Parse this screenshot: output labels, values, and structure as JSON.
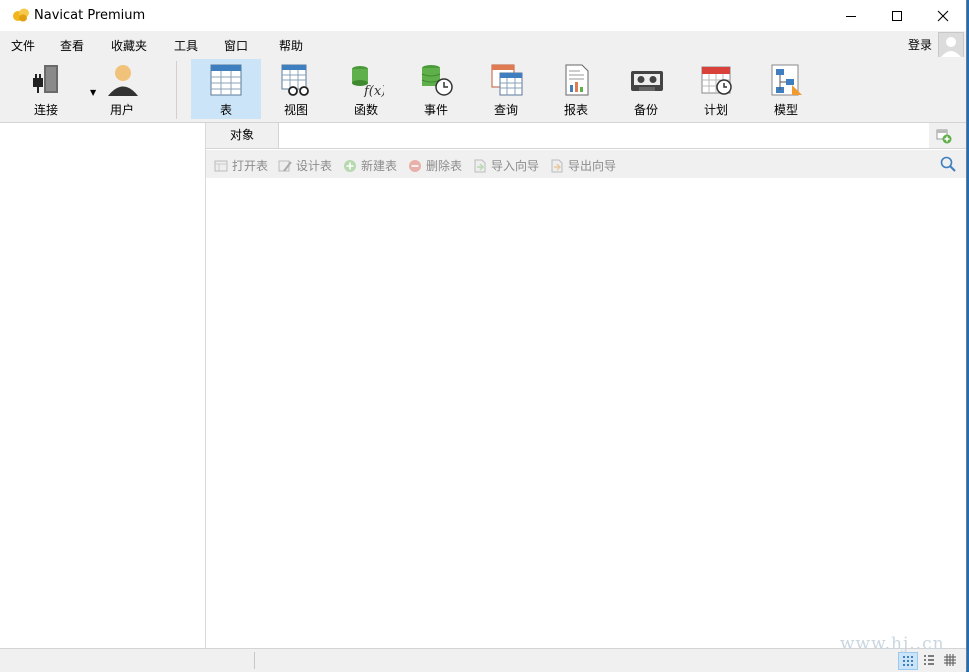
{
  "app": {
    "title": "Navicat Premium"
  },
  "menu": {
    "items": [
      {
        "label": "文件"
      },
      {
        "label": "查看"
      },
      {
        "label": "收藏夹"
      },
      {
        "label": "工具"
      },
      {
        "label": "窗口"
      },
      {
        "label": "帮助"
      }
    ],
    "login_label": "登录"
  },
  "toolbar": {
    "connect_label": "连接",
    "user_label": "用户",
    "buttons": [
      {
        "label": "表"
      },
      {
        "label": "视图"
      },
      {
        "label": "函数"
      },
      {
        "label": "事件"
      },
      {
        "label": "查询"
      },
      {
        "label": "报表"
      },
      {
        "label": "备份"
      },
      {
        "label": "计划"
      },
      {
        "label": "模型"
      }
    ]
  },
  "tabs": {
    "object_label": "对象"
  },
  "actions": {
    "open": "打开表",
    "design": "设计表",
    "new": "新建表",
    "delete": "删除表",
    "import": "导入向导",
    "export": "导出向导"
  },
  "watermark": "www.hj..cn",
  "colors": {
    "active_tab": "#cce4f7",
    "chrome": "#f0f0f0"
  }
}
